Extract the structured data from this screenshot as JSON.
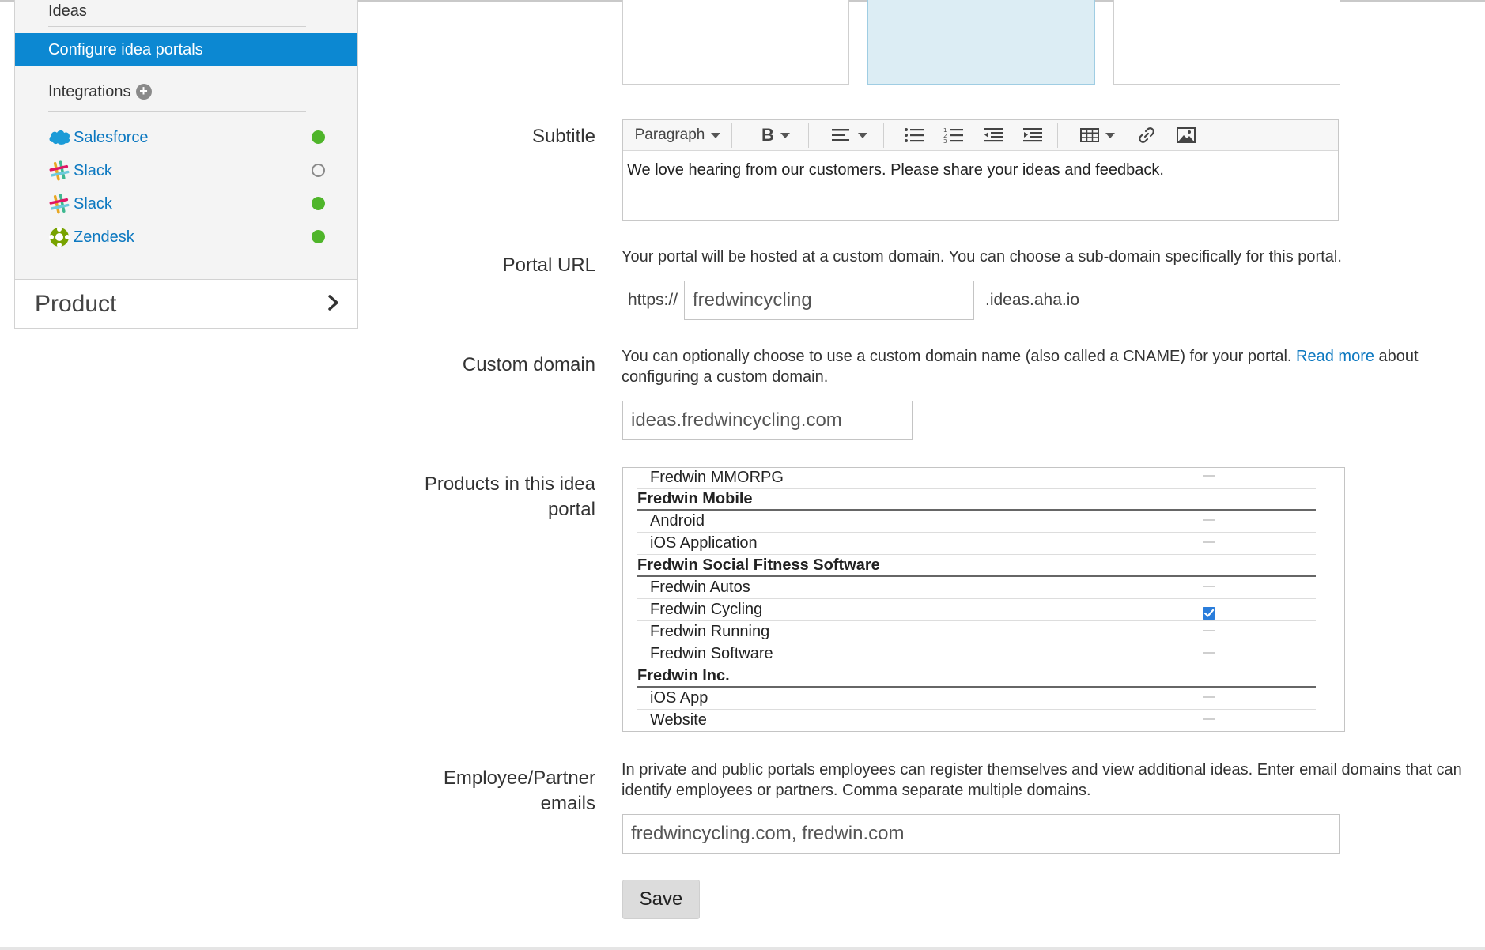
{
  "sidebar": {
    "heading": "Ideas",
    "active_item": "Configure idea portals",
    "integrations_label": "Integrations",
    "integrations": [
      {
        "name": "Salesforce",
        "icon": "salesforce-cloud-icon",
        "status": "enabled"
      },
      {
        "name": "Slack",
        "icon": "slack-icon",
        "status": "disabled"
      },
      {
        "name": "Slack",
        "icon": "slack-icon",
        "status": "enabled"
      },
      {
        "name": "Zendesk",
        "icon": "zendesk-icon",
        "status": "enabled"
      }
    ],
    "product_label": "Product"
  },
  "form": {
    "subtitle": {
      "label": "Subtitle",
      "format_option": "Paragraph",
      "bold_label": "B",
      "content": "We love hearing from our customers. Please share your ideas and feedback."
    },
    "portal_url": {
      "label": "Portal URL",
      "help": "Your portal will be hosted at a custom domain. You can choose a sub-domain specifically for this portal.",
      "prefix": "https://",
      "value": "fredwincycling",
      "suffix": ".ideas.aha.io"
    },
    "custom_domain": {
      "label": "Custom domain",
      "help_before": "You can optionally choose to use a custom domain name (also called a CNAME) for your portal.",
      "read_more": "Read more",
      "help_after": "about",
      "help_line2": "configuring a custom domain.",
      "value": "ideas.fredwincycling.com"
    },
    "products": {
      "label_line1": "Products in this idea",
      "label_line2": "portal",
      "rows": [
        {
          "name": "Fredwin MMORPG",
          "type": "child",
          "checked": false
        },
        {
          "name": "Fredwin Mobile",
          "type": "group"
        },
        {
          "name": "Android",
          "type": "child",
          "checked": false
        },
        {
          "name": "iOS Application",
          "type": "child",
          "checked": false
        },
        {
          "name": "Fredwin Social Fitness Software",
          "type": "group"
        },
        {
          "name": "Fredwin Autos",
          "type": "child",
          "checked": false
        },
        {
          "name": "Fredwin Cycling",
          "type": "child",
          "checked": true
        },
        {
          "name": "Fredwin Running",
          "type": "child",
          "checked": false
        },
        {
          "name": "Fredwin Software",
          "type": "child",
          "checked": false
        },
        {
          "name": "Fredwin Inc.",
          "type": "group"
        },
        {
          "name": "iOS App",
          "type": "child",
          "checked": false
        },
        {
          "name": "Website",
          "type": "child",
          "checked": false
        }
      ]
    },
    "emails": {
      "label_line1": "Employee/Partner",
      "label_line2": "emails",
      "help_line1": "In private and public portals employees can register themselves and view additional ideas. Enter email domains that can",
      "help_line2": "identify employees or partners. Comma separate multiple domains.",
      "value": "fredwincycling.com, fredwin.com"
    },
    "save_label": "Save"
  },
  "colors": {
    "accent": "#0c88d2",
    "link": "#0c78c0",
    "status_on": "#4fb52a",
    "checkbox": "#2a7ddb"
  }
}
